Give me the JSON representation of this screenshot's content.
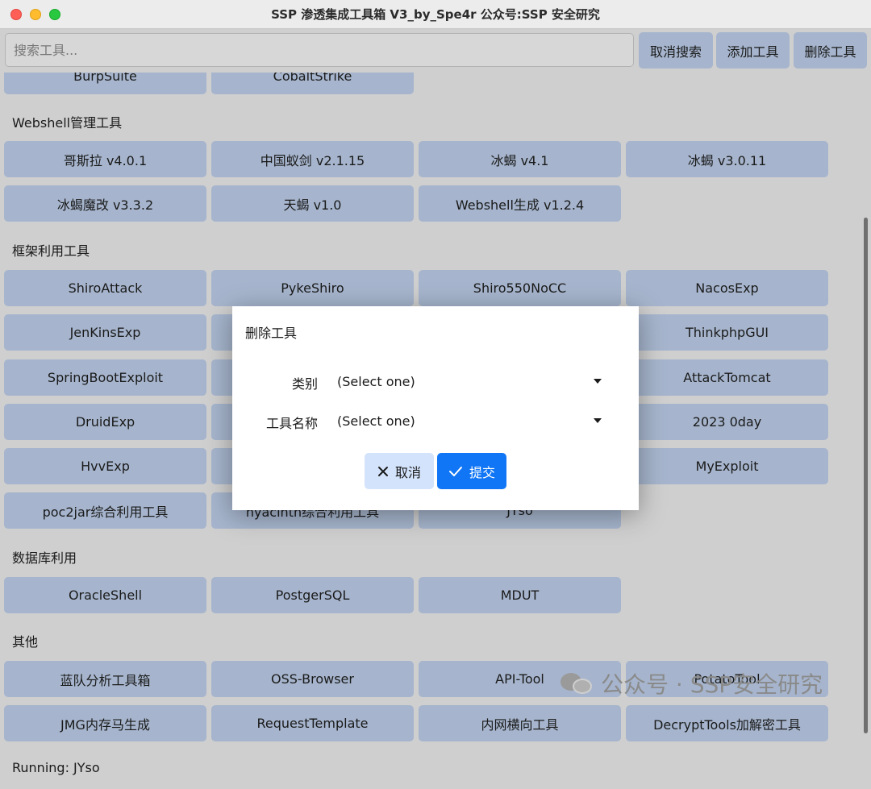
{
  "window": {
    "title": "SSP 渗透集成工具箱 V3_by_Spe4r 公众号:SSP 安全研究"
  },
  "toolbar": {
    "search_placeholder": "搜索工具...",
    "cancel_search": "取消搜索",
    "add_tool": "添加工具",
    "delete_tool": "删除工具"
  },
  "top_partial": [
    "BurpSuite",
    "CobaltStrike"
  ],
  "sections": {
    "webshell": {
      "title": "Webshell管理工具",
      "tools": [
        "哥斯拉 v4.0.1",
        "中国蚁剑 v2.1.15",
        "冰蝎 v4.1",
        "冰蝎 v3.0.11",
        "冰蝎魔改 v3.3.2",
        "天蝎 v1.0",
        "Webshell生成 v1.2.4"
      ]
    },
    "framework": {
      "title": "框架利用工具",
      "tools": [
        "ShiroAttack",
        "PykeShiro",
        "Shiro550NoCC",
        "NacosExp",
        "JenKinsExp",
        "ThinkphpGUI",
        "SpringBootExploit",
        "AttackTomcat",
        "DruidExp",
        "2023 0day",
        "HvvExp",
        "MyExploit",
        "poc2jar综合利用工具",
        "hyacinth综合利用工具",
        "JYso"
      ]
    },
    "database": {
      "title": "数据库利用",
      "tools": [
        "OracleShell",
        "PostgerSQL",
        "MDUT"
      ]
    },
    "other": {
      "title": "其他",
      "tools": [
        "蓝队分析工具箱",
        "OSS-Browser",
        "API-Tool",
        "PotatoTool",
        "JMG内存马生成",
        "RequestTemplate",
        "内网横向工具",
        "DecryptTools加解密工具"
      ]
    }
  },
  "status": {
    "text": "Running: JYso"
  },
  "watermark": {
    "text": "公众号 · SSP安全研究"
  },
  "dialog": {
    "title": "删除工具",
    "category_label": "类别",
    "category_value": "(Select one)",
    "name_label": "工具名称",
    "name_value": "(Select one)",
    "cancel_label": "取消",
    "submit_label": "提交"
  },
  "colors": {
    "tool_button": "#a6b5cd",
    "primary": "#1176f5",
    "secondary": "#d3e3fb"
  }
}
